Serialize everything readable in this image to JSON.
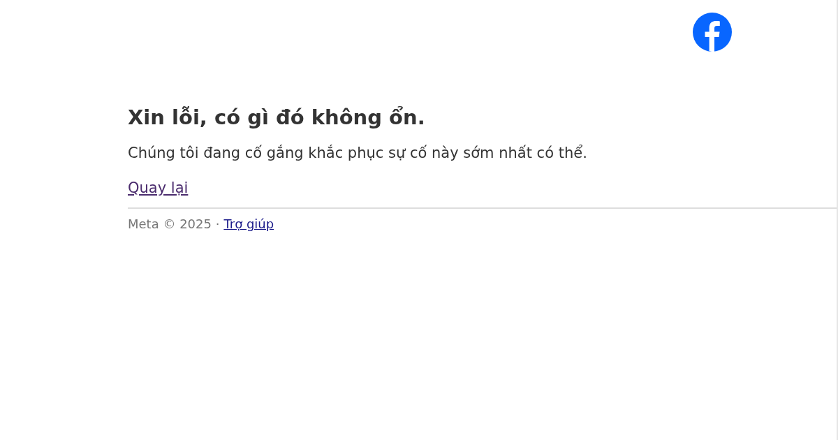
{
  "heading": "Xin lỗi, có gì đó không ổn.",
  "message": "Chúng tôi đang cố gắng khắc phục sự cố này sớm nhất có thể.",
  "back_link": "Quay lại",
  "footer": {
    "copyright": "Meta © 2025 ·",
    "help_link": "Trợ giúp"
  }
}
